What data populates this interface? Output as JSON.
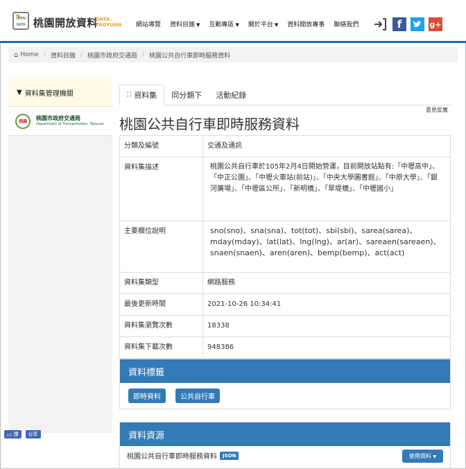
{
  "header": {
    "logo_badge": "OPEN DATA",
    "site_title": "桃園開放資料",
    "site_sub_line1": "DATA.",
    "site_sub_line2": "TAOYUAN",
    "nav": [
      {
        "label": "網站導覽",
        "dropdown": false
      },
      {
        "label": "資料目錄",
        "dropdown": true
      },
      {
        "label": "互動專區",
        "dropdown": true
      },
      {
        "label": "關於平台",
        "dropdown": true
      },
      {
        "label": "資料開放專事",
        "dropdown": false
      },
      {
        "label": "聯絡我們",
        "dropdown": false
      }
    ],
    "fb_glyph": "f",
    "gplus_glyph": "g+"
  },
  "breadcrumb": {
    "home": "Home",
    "items": [
      "資料目錄",
      "桃園市政府交通局",
      "桃園公共自行車即時服務資料"
    ]
  },
  "sidebar": {
    "heading": "資料集管理機關",
    "org_badge": "桃園",
    "org_name": "桃園市政府交通局",
    "org_name_en": "Department of Transportation, Taoyuan"
  },
  "social": {
    "like": "讚",
    "share": "分享"
  },
  "tabs": [
    {
      "label": "資料集",
      "active": true
    },
    {
      "label": "同分類下",
      "active": false
    },
    {
      "label": "活動紀錄",
      "active": false
    }
  ],
  "feedback": "意見反應",
  "title": "桃園公共自行車即時服務資料",
  "info": [
    {
      "key": "分類及編號",
      "value": "交通及通訊"
    },
    {
      "key": "資料集描述",
      "value": "桃園公共自行車於105年2月4日開始營運，目前開放站點有:「中壢高中」、「中正公園」、「中壢火車站(前站)」、「中央大學圖書館」、「中原大學」、「銀河廣場」、「中壢區公所」、「新明橋」、「翠堤橋」、「中壢國小」"
    },
    {
      "key": "主要欄位說明",
      "value": "sno(sno)、sna(sna)、tot(tot)、sbi(sbi)、sarea(sarea)、mday(mday)、lat(lat)、lng(lng)、ar(ar)、sareaen(sareaen)、snaen(snaen)、aren(aren)、bemp(bemp)、act(act)"
    },
    {
      "key": "資料集類型",
      "value": "網路服務"
    },
    {
      "key": "最後更新時間",
      "value": "2021-10-26 10:34:41"
    },
    {
      "key": "資料集瀏覽次數",
      "value": "18338"
    },
    {
      "key": "資料集下載次數",
      "value": "948386"
    }
  ],
  "tags_panel": {
    "heading": "資料標籤",
    "tags": [
      "即時資料",
      "公共自行車"
    ]
  },
  "resource_panel": {
    "heading": "資料資源",
    "resource_name": "桃園公共自行車即時服務資料",
    "format": "JSON",
    "use_button": "使用資料"
  }
}
